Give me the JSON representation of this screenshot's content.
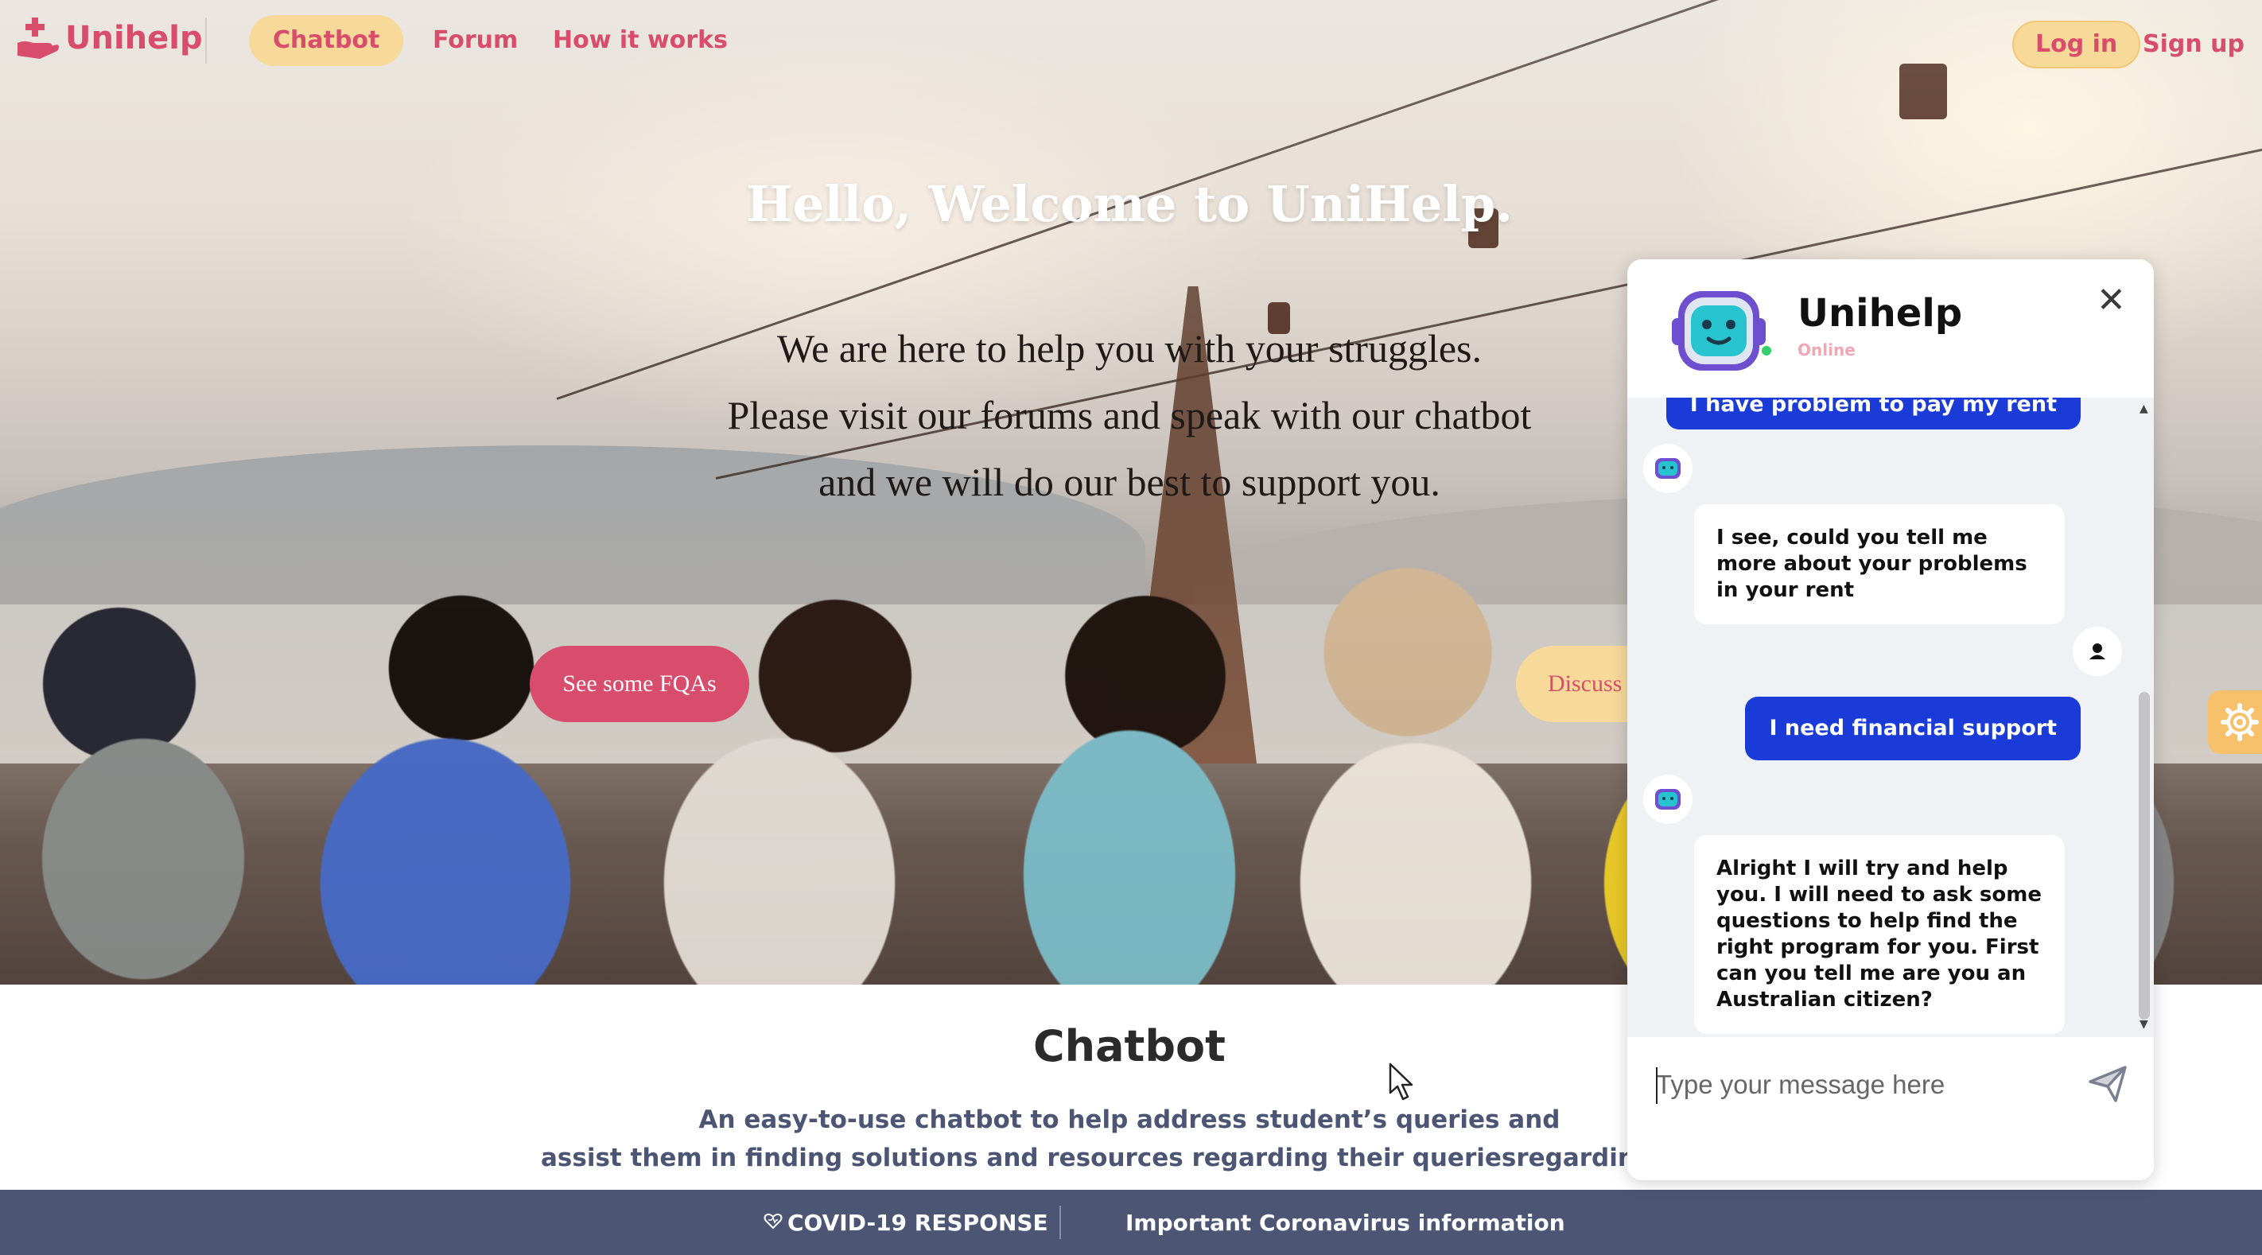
{
  "nav": {
    "logo": "Unihelp",
    "links": [
      "Chatbot",
      "Forum",
      "How it works"
    ],
    "login": "Log in",
    "signup": "Sign up"
  },
  "hero": {
    "title": "Hello, Welcome to UniHelp.",
    "lines": [
      "We are here to help you with your struggles.",
      "Please visit our forums and speak with our chatbot",
      "and we will do our best to support you."
    ],
    "btn_faq": "See some FQAs",
    "btn_discuss": "Discuss"
  },
  "section": {
    "title": "Chatbot",
    "desc_line1": "An easy-to-use chatbot to help address student’s queries and",
    "desc_line2": "assist them in finding solutions and resources regarding their queriesregarding their well"
  },
  "footer": {
    "covid": "COVID-19 RESPONSE",
    "important": "Important Coronavirus information"
  },
  "chat": {
    "name": "Unihelp",
    "status": "Online",
    "messages": [
      {
        "from": "user",
        "text": "I have problem to pay my rent"
      },
      {
        "from": "bot",
        "text": "I see, could you tell me more about your problems in your rent"
      },
      {
        "from": "user",
        "text": "I need financial support"
      },
      {
        "from": "bot",
        "text": "Alright I will try and help you. I will need to ask some questions to help find the right program for you. First can you tell me are you an Australian citizen?"
      }
    ],
    "input_placeholder": "Type your message here"
  },
  "colors": {
    "brand_pink": "#d84d6b",
    "brand_yellow": "#f7d999",
    "user_bubble": "#1a3bd8",
    "footer": "#4c5573",
    "online": "#33d06b"
  },
  "icons": [
    "logo-hand-icon",
    "robot-icon",
    "user-icon",
    "close-icon",
    "send-icon",
    "gear-icon",
    "heart-icon",
    "cursor-icon"
  ]
}
